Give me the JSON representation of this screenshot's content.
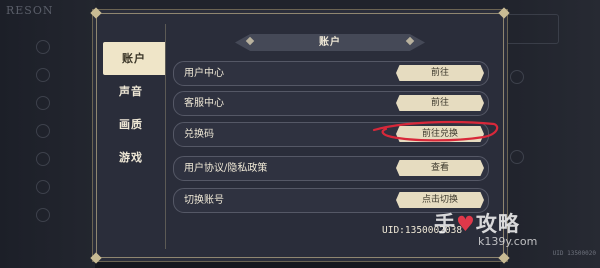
{
  "background": {
    "game_title": "RESON"
  },
  "dialog": {
    "header": "账户",
    "nav": [
      {
        "label": "账户",
        "active": true
      },
      {
        "label": "声音",
        "active": false
      },
      {
        "label": "画质",
        "active": false
      },
      {
        "label": "游戏",
        "active": false
      }
    ],
    "rows": [
      {
        "label": "用户中心",
        "button": "前往"
      },
      {
        "label": "客服中心",
        "button": "前往"
      },
      {
        "label": "兑换码",
        "button": "前往兑换"
      },
      {
        "label": "用户协议/隐私政策",
        "button": "查看"
      },
      {
        "label": "切换账号",
        "button": "点击切换"
      }
    ],
    "uid": "UID:1350002038"
  },
  "watermark": {
    "main_before": "手",
    "main_heart": "♥",
    "main_after": "攻略",
    "sub": "k139y.com",
    "corner_tag": "UID 13500020"
  },
  "colors": {
    "dialog_bg": "#2a2d3a",
    "button_bg": "#e6dcc0",
    "active_nav_bg": "#efe5c8",
    "annotation_red": "#d8283a"
  }
}
